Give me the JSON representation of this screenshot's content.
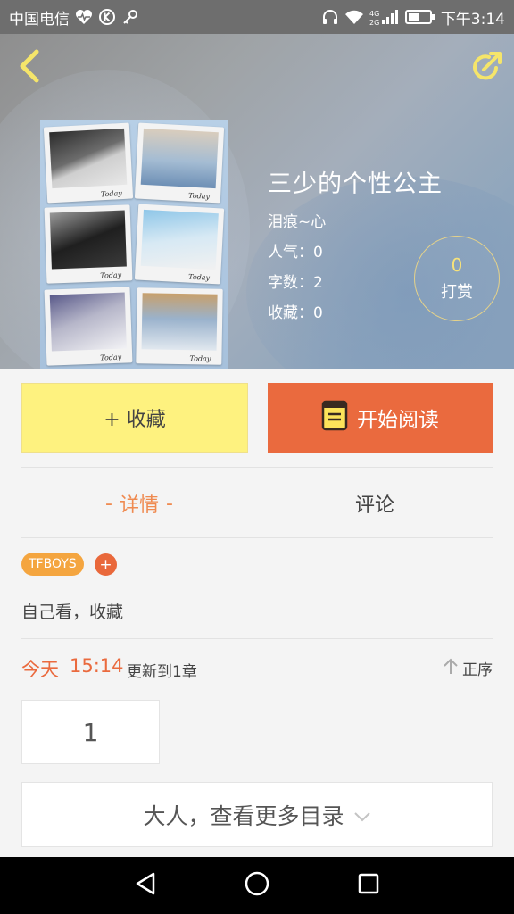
{
  "status_bar": {
    "carrier": "中国电信",
    "network": "4G",
    "time": "下午3:14"
  },
  "header": {
    "icons": {
      "back": "back-chevron-icon",
      "share": "share-icon"
    }
  },
  "book": {
    "title": "三少的个性公主",
    "author": "泪痕~心",
    "popularity": "人气：0",
    "word_count": "字数：2",
    "favorites": "收藏：0",
    "cover_signature": "Today"
  },
  "tip": {
    "count": "0",
    "label": "打赏"
  },
  "actions": {
    "favorite_label": "+ 收藏",
    "read_label": "开始阅读"
  },
  "tabs": [
    {
      "label": "详情",
      "active": true
    },
    {
      "label": "评论",
      "active": false
    }
  ],
  "tags": [
    "TFBOYS"
  ],
  "tag_add": "+",
  "summary": "自己看，收藏",
  "update": {
    "day": "今天",
    "time": "15:14",
    "text": "更新到1章",
    "sort_label": "正序"
  },
  "chapters": {
    "visible": "1",
    "more_label": "大人，查看更多目录"
  },
  "colors": {
    "accent_orange": "#ea6a3e",
    "tab_active": "#ef8a50",
    "favorite_yellow": "#fef27f",
    "tag_orange": "#f4a53f",
    "tip_gold": "#f7e27a"
  }
}
